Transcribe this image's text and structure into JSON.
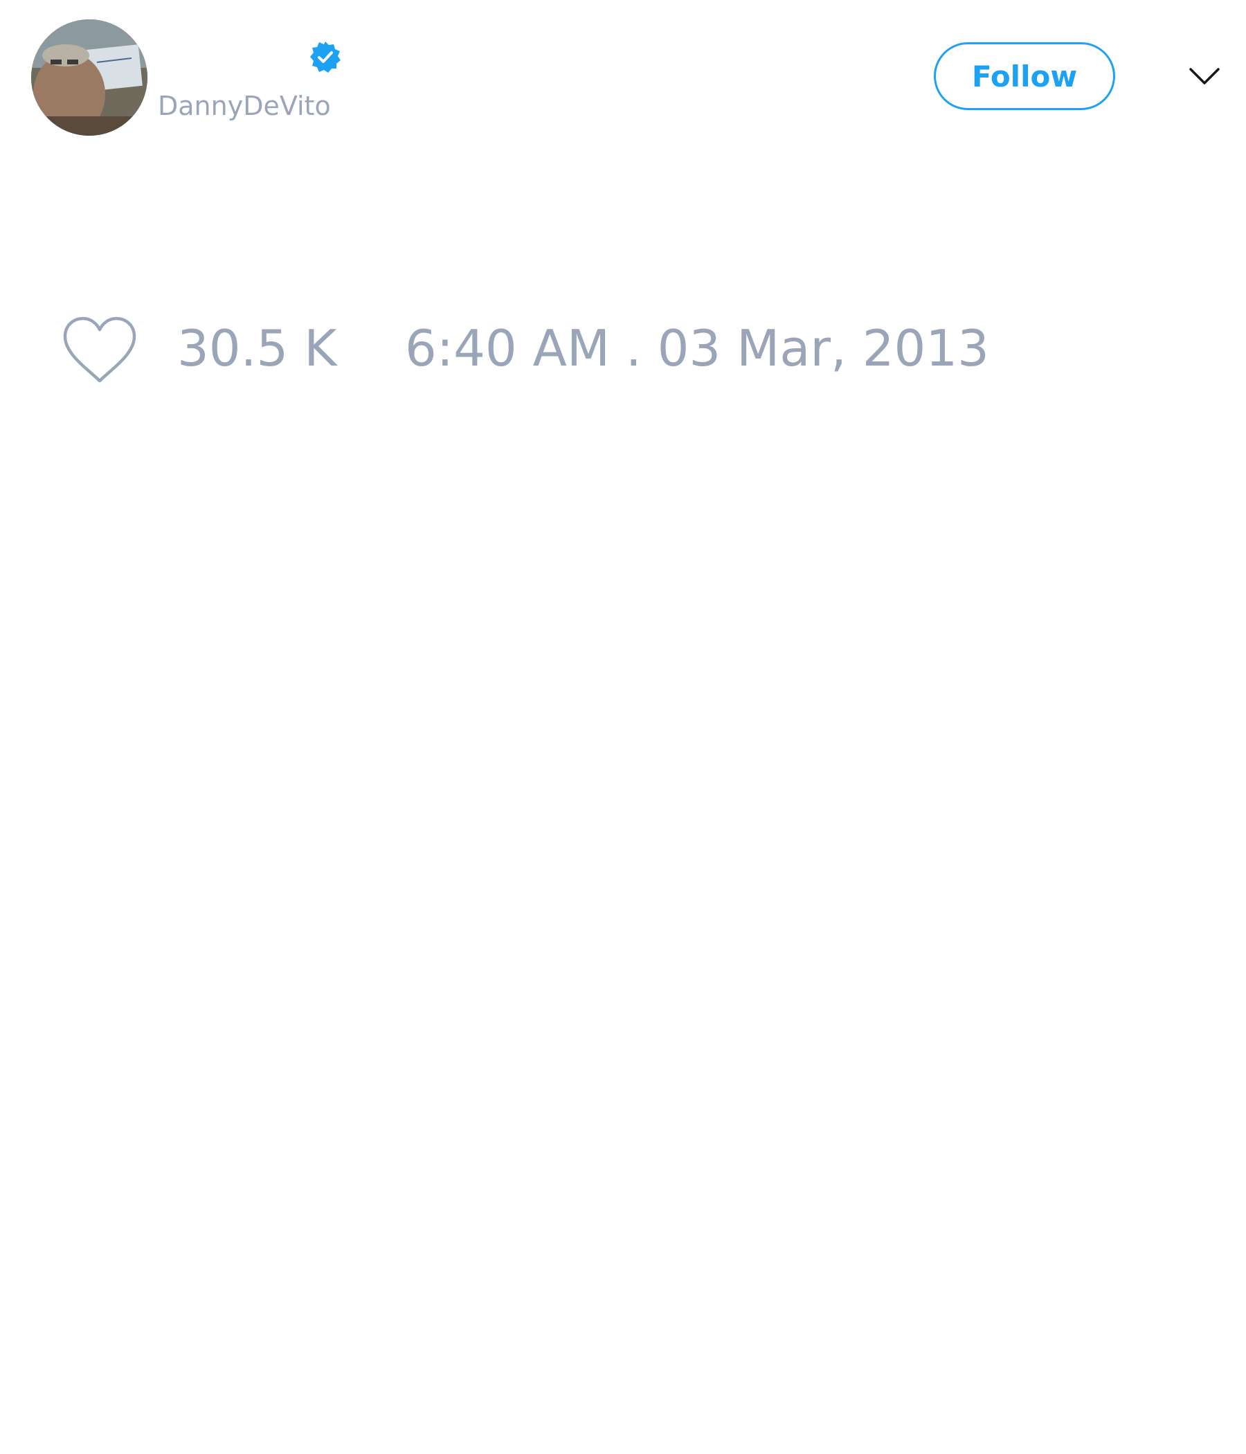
{
  "header": {
    "display_name": "",
    "username": "DannyDeVito",
    "verified": true,
    "avatar": {
      "description": "profile-photo"
    },
    "follow_label": "Follow",
    "menu_icon": "chevron-down-icon"
  },
  "footer": {
    "like_icon": "heart-outline-icon",
    "like_count": "30.5 K",
    "timestamp": "6:40 AM . 03 Mar, 2013"
  },
  "colors": {
    "accent": "#1da1f2",
    "muted_text": "#9aa6b8",
    "background": "#ffffff"
  }
}
